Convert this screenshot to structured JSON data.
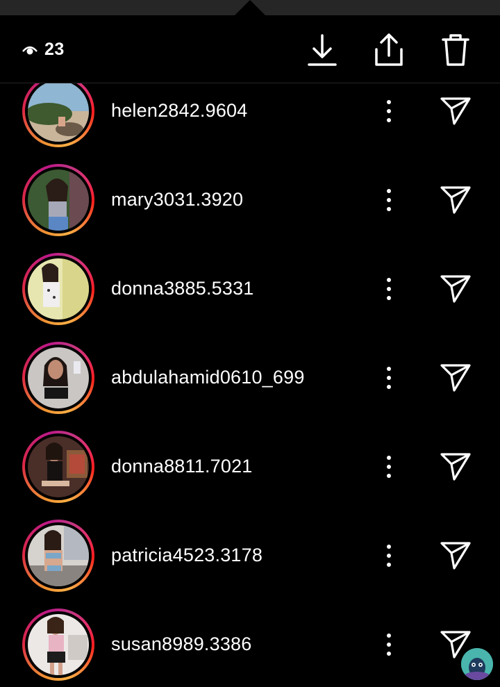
{
  "header": {
    "viewer_count": "23",
    "icons": [
      "eye-icon",
      "download-icon",
      "share-icon",
      "trash-icon"
    ]
  },
  "viewers": [
    {
      "username": "helen2842.9604"
    },
    {
      "username": "mary3031.3920"
    },
    {
      "username": "donna3885.5331"
    },
    {
      "username": "abdulahamid0610_699"
    },
    {
      "username": "donna8811.7021"
    },
    {
      "username": "patricia4523.3178"
    },
    {
      "username": "susan8989.3386"
    }
  ],
  "colors": {
    "background": "#000000",
    "text": "#ffffff",
    "divider": "#262626",
    "ring_gradient": [
      "#f09433",
      "#dc2743",
      "#bc1888",
      "#fcaf45"
    ]
  }
}
